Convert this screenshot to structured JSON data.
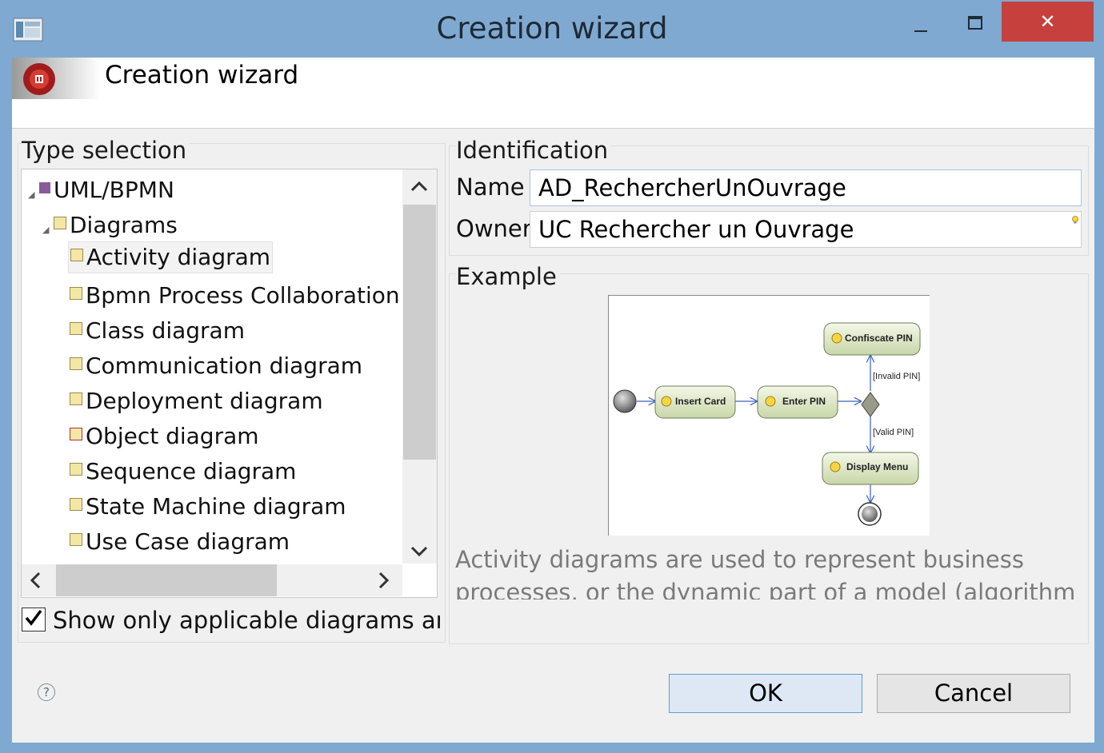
{
  "window": {
    "title": "Creation wizard",
    "close_glyph": "✕"
  },
  "banner": {
    "title": "Creation wizard"
  },
  "type_selection": {
    "title": "Type selection",
    "tree": [
      {
        "label": "UML/BPMN",
        "level": 0,
        "expanded": true
      },
      {
        "label": "Diagrams",
        "level": 1,
        "expanded": true
      },
      {
        "label": "Activity diagram",
        "level": 2,
        "selected": true
      },
      {
        "label": "Bpmn Process Collaboration d",
        "level": 2
      },
      {
        "label": "Class diagram",
        "level": 2
      },
      {
        "label": "Communication diagram",
        "level": 2
      },
      {
        "label": "Deployment diagram",
        "level": 2
      },
      {
        "label": "Object diagram",
        "level": 2
      },
      {
        "label": "Sequence diagram",
        "level": 2
      },
      {
        "label": "State Machine diagram",
        "level": 2
      },
      {
        "label": "Use Case diagram",
        "level": 2
      }
    ],
    "checkbox_label": "Show only applicable diagrams and r",
    "checkbox_checked": true
  },
  "identification": {
    "title": "Identification",
    "name_label": "Name",
    "name_value": "AD_RechercherUnOuvrage",
    "owner_label": "Owner",
    "owner_value": "UC Rechercher un Ouvrage"
  },
  "example": {
    "title": "Example",
    "diagram": {
      "nodes": [
        "Insert Card",
        "Enter PIN",
        "Confiscate PIN",
        "Display Menu"
      ],
      "guards": [
        "[Invalid PIN]",
        "[Valid PIN]"
      ]
    },
    "description": "Activity diagrams are used to represent business processes, or the dynamic part of a model (algorithm of an"
  },
  "footer": {
    "help_glyph": "?",
    "ok_label": "OK",
    "cancel_label": "Cancel"
  },
  "colors": {
    "window_frame": "#7fa9d1",
    "close_button": "#c6413e",
    "dialog_bg": "#f0f0f0"
  }
}
